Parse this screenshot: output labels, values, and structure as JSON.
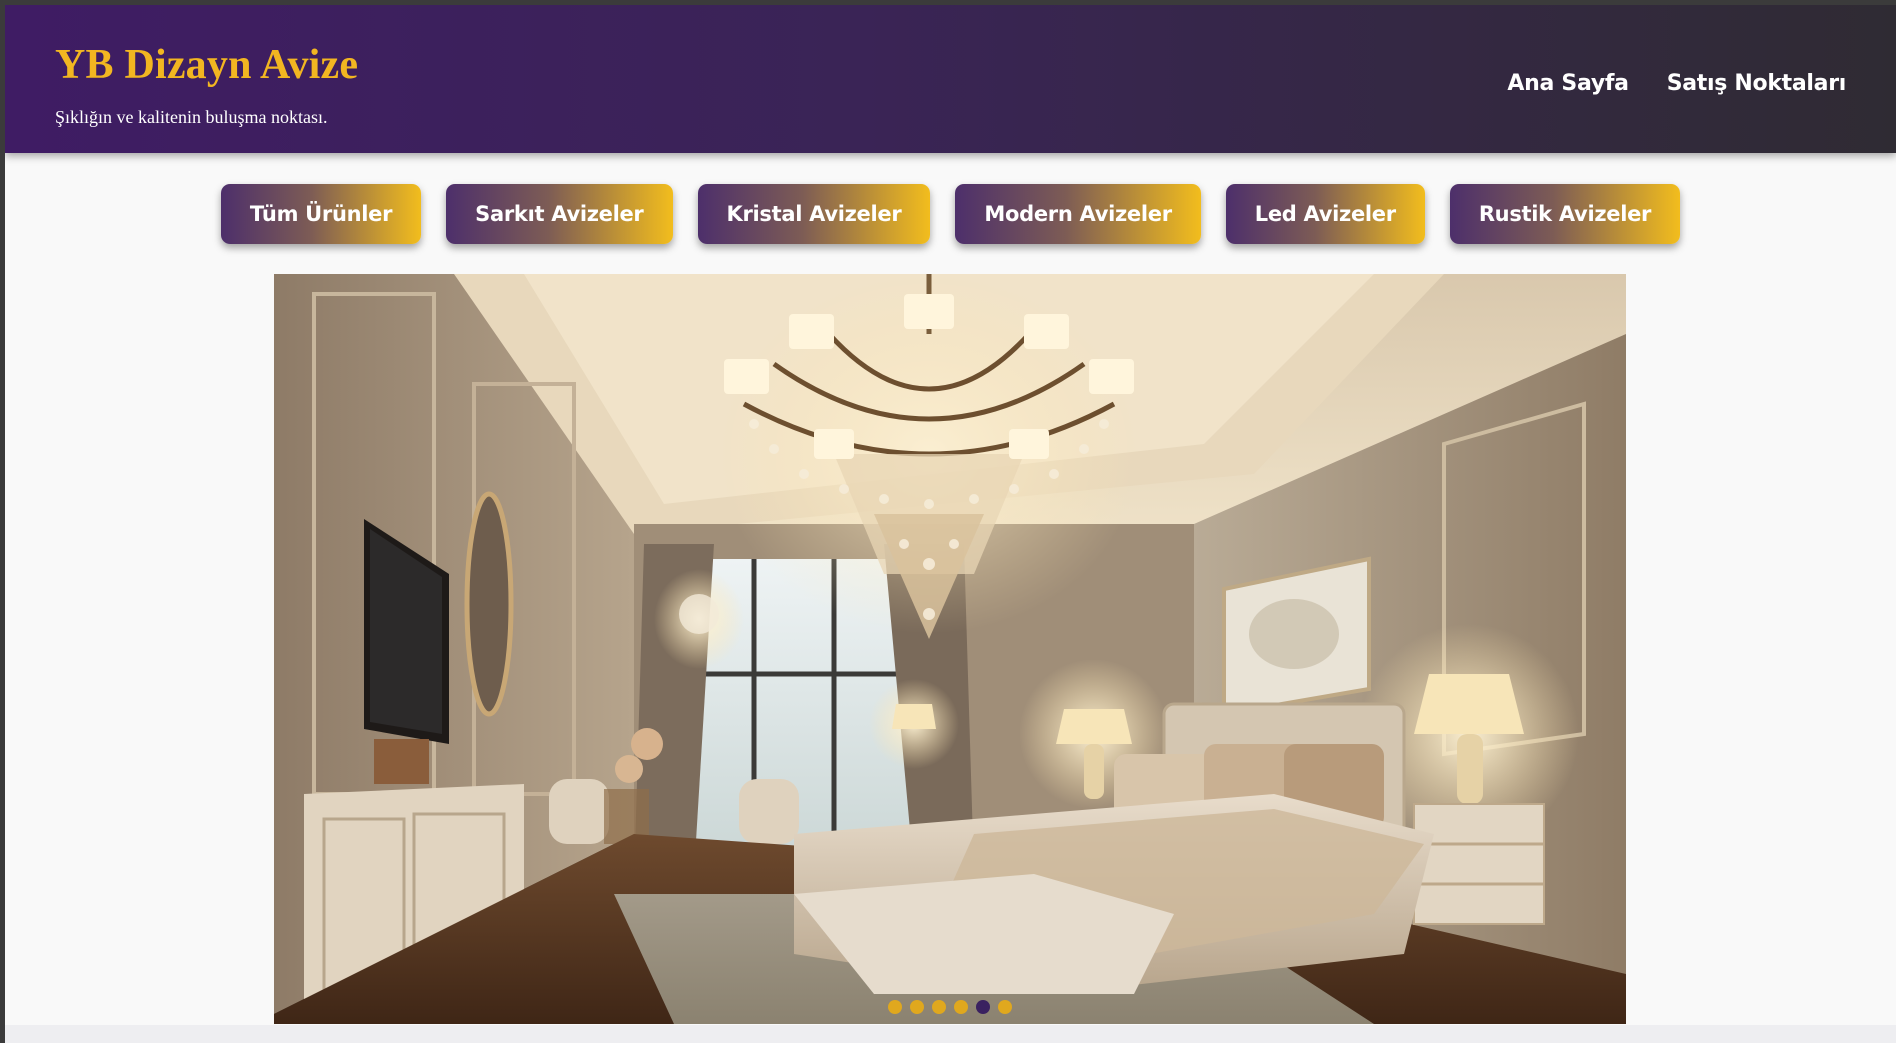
{
  "header": {
    "title": "YB Dizayn Avize",
    "tagline": "Şıklığın ve kalitenin buluşma noktası.",
    "nav": [
      {
        "label": "Ana Sayfa"
      },
      {
        "label": "Satış Noktaları"
      }
    ]
  },
  "categories": [
    {
      "label": "Tüm Ürünler"
    },
    {
      "label": "Sarkıt Avizeler"
    },
    {
      "label": "Kristal Avizeler"
    },
    {
      "label": "Modern Avizeler"
    },
    {
      "label": "Led Avizeler"
    },
    {
      "label": "Rustik Avizeler"
    }
  ],
  "hero": {
    "image": "luxury-bedroom-crystal-chandelier-photo",
    "slide_count": 6,
    "active_slide": 5
  },
  "colors": {
    "brand_gold": "#f2b621",
    "header_purple": "#3f1c64",
    "dot_inactive": "#e0a81e",
    "dot_active": "#3a2160"
  }
}
